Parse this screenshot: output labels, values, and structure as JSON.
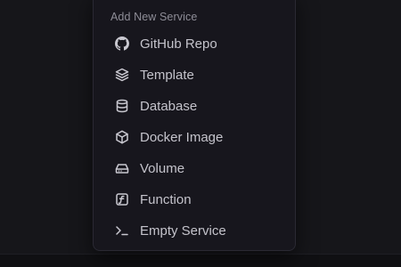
{
  "menu": {
    "header": "Add New Service",
    "items": [
      {
        "label": "GitHub Repo",
        "icon": "github-icon"
      },
      {
        "label": "Template",
        "icon": "layers-icon"
      },
      {
        "label": "Database",
        "icon": "database-icon"
      },
      {
        "label": "Docker Image",
        "icon": "box-icon"
      },
      {
        "label": "Volume",
        "icon": "hard-drive-icon"
      },
      {
        "label": "Function",
        "icon": "function-icon"
      },
      {
        "label": "Empty Service",
        "icon": "terminal-icon"
      }
    ]
  },
  "colors": {
    "background": "#16161a",
    "menu_background": "#17161d",
    "menu_border": "#2a2933",
    "header_text": "#8e8d97",
    "item_text": "#c4c3cb"
  }
}
